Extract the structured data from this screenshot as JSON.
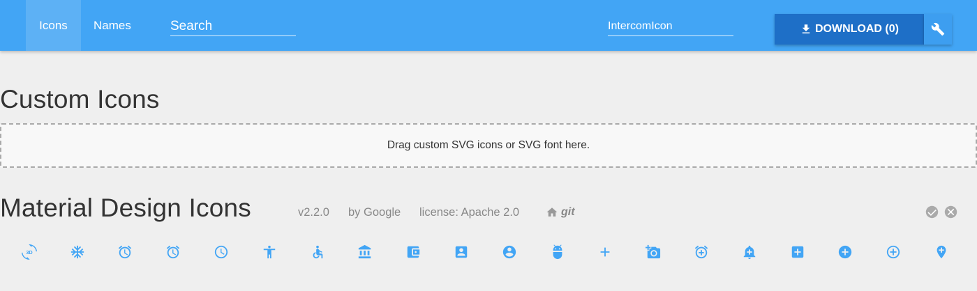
{
  "nav": {
    "tabs": [
      {
        "label": "Icons",
        "active": true
      },
      {
        "label": "Names",
        "active": false
      }
    ]
  },
  "search": {
    "placeholder": "Search",
    "value": ""
  },
  "font_name": {
    "value": "IntercomIcon"
  },
  "download": {
    "label": "DOWNLOAD (0)",
    "icon": "download-icon"
  },
  "settings": {
    "icon": "wrench-icon"
  },
  "custom_section": {
    "title": "Custom Icons",
    "dropzone_text": "Drag custom SVG icons or SVG font here."
  },
  "material_section": {
    "title": "Material Design Icons",
    "version": "v2.2.0",
    "author": "by Google",
    "license": "license: Apache 2.0",
    "git_label": "git",
    "home_icon": "home-icon",
    "select_all_icon": "check-circle-icon",
    "deselect_icon": "cancel-circle-icon"
  },
  "icons": [
    "3d-rotation-icon",
    "ac-unit-icon",
    "access-alarm-icon",
    "access-alarms-icon",
    "access-time-icon",
    "accessibility-icon",
    "accessible-icon",
    "account-balance-icon",
    "account-balance-wallet-icon",
    "account-box-icon",
    "account-circle-icon",
    "adb-icon",
    "add-icon",
    "add-a-photo-icon",
    "add-alarm-icon",
    "add-alert-icon",
    "add-box-icon",
    "add-circle-icon",
    "add-circle-outline-icon",
    "add-location-icon"
  ],
  "colors": {
    "accent": "#42a5f5",
    "download_bg": "#1e6fc7",
    "icon_color": "#42a5f5",
    "meta_gray": "#888888"
  }
}
